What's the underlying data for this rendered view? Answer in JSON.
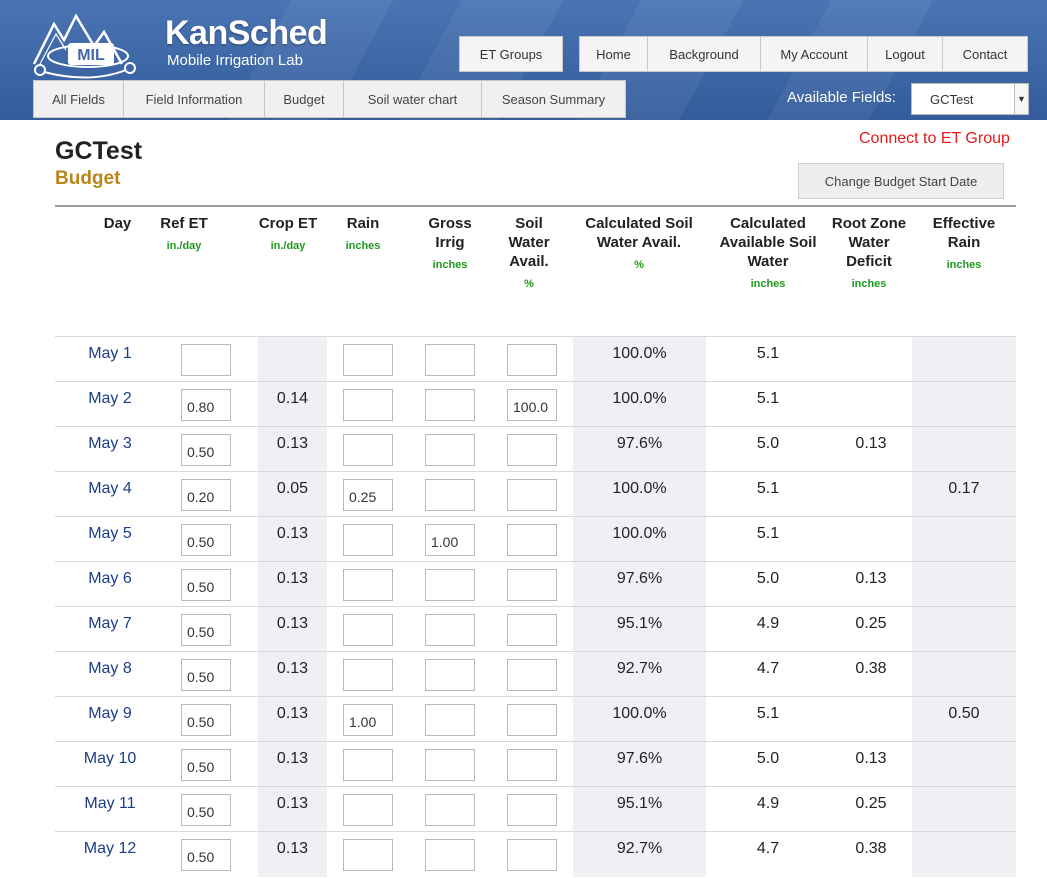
{
  "brand": {
    "logo_text": "MIL",
    "title": "KanSched",
    "subtitle": "Mobile Irrigation Lab",
    "accent_color": "#3f69a8"
  },
  "topnav": [
    {
      "label": "ET Groups"
    },
    {
      "label": "Home"
    },
    {
      "label": "Background"
    },
    {
      "label": "My Account"
    },
    {
      "label": "Logout"
    },
    {
      "label": "Contact"
    }
  ],
  "subtabs": [
    {
      "label": "All Fields"
    },
    {
      "label": "Field Information"
    },
    {
      "label": "Budget"
    },
    {
      "label": "Soil water chart"
    },
    {
      "label": "Season Summary"
    }
  ],
  "field_selector": {
    "label": "Available Fields:",
    "selected": "GCTest"
  },
  "page": {
    "field_name": "GCTest",
    "section": "Budget",
    "connect_link": "Connect to ET Group",
    "change_date_button": "Change Budget Start Date"
  },
  "table": {
    "columns": [
      {
        "title": "Day",
        "unit": ""
      },
      {
        "title": "Ref ET",
        "unit": "in./day"
      },
      {
        "title": "Crop ET",
        "unit": "in./day"
      },
      {
        "title": "Rain",
        "unit": "inches"
      },
      {
        "title": "Gross Irrig",
        "unit": "inches"
      },
      {
        "title": "Soil Water Avail.",
        "unit": "%"
      },
      {
        "title": "Calculated Soil Water Avail.",
        "unit": "%"
      },
      {
        "title": "Calculated Available Soil Water",
        "unit": "inches"
      },
      {
        "title": "Root Zone Water Deficit",
        "unit": "inches"
      },
      {
        "title": "Effective Rain",
        "unit": "inches"
      }
    ],
    "rows": [
      {
        "day": "May 1",
        "ref_et": "",
        "crop_et": "",
        "rain": "",
        "gross_irrig": "",
        "soil_water": "",
        "calc_pct": "100.0%",
        "calc_in": "5.1",
        "deficit": "",
        "eff_rain": ""
      },
      {
        "day": "May 2",
        "ref_et": "0.80",
        "crop_et": "0.14",
        "rain": "",
        "gross_irrig": "",
        "soil_water": "100.0",
        "calc_pct": "100.0%",
        "calc_in": "5.1",
        "deficit": "",
        "eff_rain": ""
      },
      {
        "day": "May 3",
        "ref_et": "0.50",
        "crop_et": "0.13",
        "rain": "",
        "gross_irrig": "",
        "soil_water": "",
        "calc_pct": "97.6%",
        "calc_in": "5.0",
        "deficit": "0.13",
        "eff_rain": ""
      },
      {
        "day": "May 4",
        "ref_et": "0.20",
        "crop_et": "0.05",
        "rain": "0.25",
        "gross_irrig": "",
        "soil_water": "",
        "calc_pct": "100.0%",
        "calc_in": "5.1",
        "deficit": "",
        "eff_rain": "0.17"
      },
      {
        "day": "May 5",
        "ref_et": "0.50",
        "crop_et": "0.13",
        "rain": "",
        "gross_irrig": "1.00",
        "soil_water": "",
        "calc_pct": "100.0%",
        "calc_in": "5.1",
        "deficit": "",
        "eff_rain": ""
      },
      {
        "day": "May 6",
        "ref_et": "0.50",
        "crop_et": "0.13",
        "rain": "",
        "gross_irrig": "",
        "soil_water": "",
        "calc_pct": "97.6%",
        "calc_in": "5.0",
        "deficit": "0.13",
        "eff_rain": ""
      },
      {
        "day": "May 7",
        "ref_et": "0.50",
        "crop_et": "0.13",
        "rain": "",
        "gross_irrig": "",
        "soil_water": "",
        "calc_pct": "95.1%",
        "calc_in": "4.9",
        "deficit": "0.25",
        "eff_rain": ""
      },
      {
        "day": "May 8",
        "ref_et": "0.50",
        "crop_et": "0.13",
        "rain": "",
        "gross_irrig": "",
        "soil_water": "",
        "calc_pct": "92.7%",
        "calc_in": "4.7",
        "deficit": "0.38",
        "eff_rain": ""
      },
      {
        "day": "May 9",
        "ref_et": "0.50",
        "crop_et": "0.13",
        "rain": "1.00",
        "gross_irrig": "",
        "soil_water": "",
        "calc_pct": "100.0%",
        "calc_in": "5.1",
        "deficit": "",
        "eff_rain": "0.50"
      },
      {
        "day": "May 10",
        "ref_et": "0.50",
        "crop_et": "0.13",
        "rain": "",
        "gross_irrig": "",
        "soil_water": "",
        "calc_pct": "97.6%",
        "calc_in": "5.0",
        "deficit": "0.13",
        "eff_rain": ""
      },
      {
        "day": "May 11",
        "ref_et": "0.50",
        "crop_et": "0.13",
        "rain": "",
        "gross_irrig": "",
        "soil_water": "",
        "calc_pct": "95.1%",
        "calc_in": "4.9",
        "deficit": "0.25",
        "eff_rain": ""
      },
      {
        "day": "May 12",
        "ref_et": "0.50",
        "crop_et": "0.13",
        "rain": "",
        "gross_irrig": "",
        "soil_water": "",
        "calc_pct": "92.7%",
        "calc_in": "4.7",
        "deficit": "0.38",
        "eff_rain": ""
      }
    ]
  }
}
